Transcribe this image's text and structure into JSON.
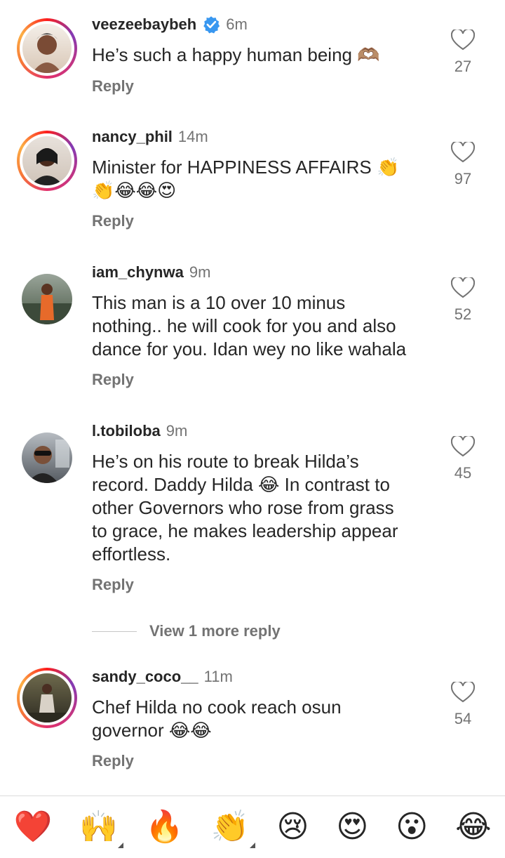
{
  "comments": [
    {
      "username": "veezeebaybeh",
      "verified": true,
      "time": "6m",
      "text": "He’s such a happy human being 🫶🏽",
      "reply": "Reply",
      "likes": "27"
    },
    {
      "username": "nancy_phil",
      "verified": false,
      "time": "14m",
      "text_line1": "Minister for HAPPINESS AFFAIRS 👏",
      "text_line2": "👏😂😂😍",
      "reply": "Reply",
      "likes": "97"
    },
    {
      "username": "iam_chynwa",
      "verified": false,
      "time": "9m",
      "text_line1": "This man is a 10 over 10 minus",
      "text_line2": "nothing.. he will cook for you and also",
      "text_line3": "dance for you. Idan wey no like wahala",
      "reply": "Reply",
      "likes": "52"
    },
    {
      "username": "l.tobiloba",
      "verified": false,
      "time": "9m",
      "text_line1": "He’s on his route to break Hilda’s",
      "text_line2": "record. Daddy Hilda 😂 In contrast to",
      "text_line3": "other Governors who rose from grass",
      "text_line4": "to grace, he makes leadership appear",
      "text_line5": "effortless.",
      "reply": "Reply",
      "likes": "45"
    },
    {
      "username": "sandy_coco__",
      "verified": false,
      "time": "11m",
      "text_line1": "Chef Hilda no cook reach osun",
      "text_line2": "governor 😂😂",
      "reply": "Reply",
      "likes": "54"
    }
  ],
  "view_more": "View 1 more reply",
  "quick_reactions": [
    "❤️",
    "🙌",
    "🔥",
    "👏",
    "😢",
    "😍",
    "😮",
    "😂"
  ],
  "colors": {
    "text": "#262626",
    "secondary": "#737373",
    "verified": "#3897f0",
    "divider": "#dbdbdb"
  }
}
